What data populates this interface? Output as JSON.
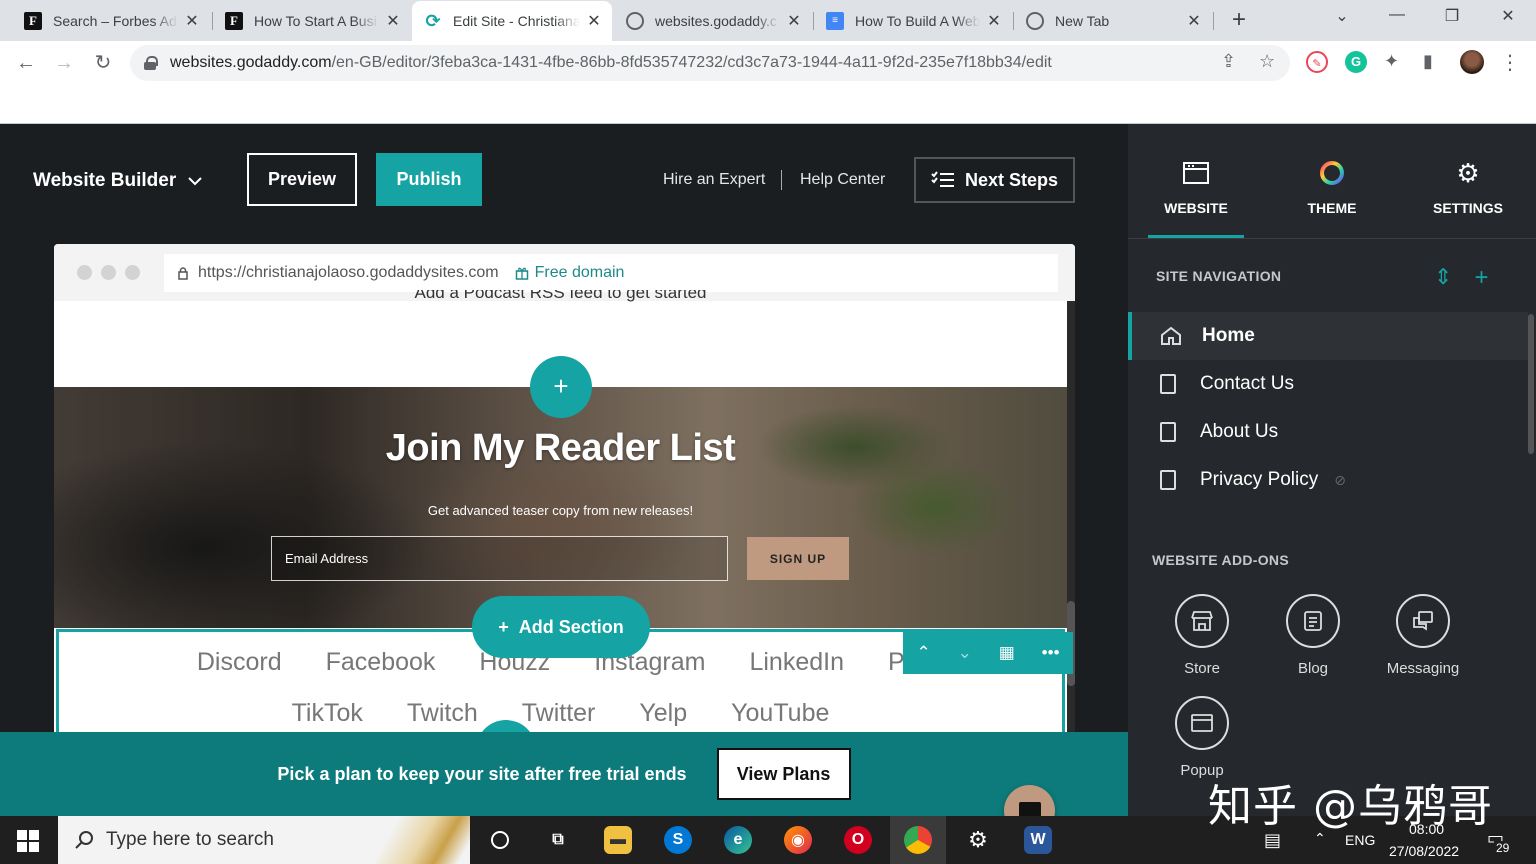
{
  "browser": {
    "tabs": [
      {
        "title": "Search – Forbes Ad",
        "favicon": "forbes-f"
      },
      {
        "title": "How To Start A Busi",
        "favicon": "forbes-f"
      },
      {
        "title": "Edit Site - Christiana",
        "favicon": "godaddy"
      },
      {
        "title": "websites.godaddy.c",
        "favicon": "globe"
      },
      {
        "title": "How To Build A Web",
        "favicon": "docs"
      },
      {
        "title": "New Tab",
        "favicon": "globe"
      }
    ],
    "favicon_letter": "F",
    "docs_glyph": "≡",
    "godaddy_glyph": "⟳",
    "close_glyph": "✕",
    "newtab_glyph": "+",
    "url_host": "websites.godaddy.com",
    "url_path": "/en-GB/editor/3feba3ca-1431-4fbe-86bb-8fd535747232/cd3c7a73-1944-4a11-9f2d-235e7f18bb34/edit",
    "grammarly_glyph": "G"
  },
  "editor": {
    "title": "Website Builder",
    "preview_label": "Preview",
    "publish_label": "Publish",
    "hire_expert": "Hire an Expert",
    "help_center": "Help Center",
    "next_steps": "Next Steps",
    "colors": {
      "accent": "#15a3a3",
      "banner": "#0d7b7b",
      "signup": "#c09a80"
    }
  },
  "preview": {
    "site_url": "https://christianajolaoso.godaddysites.com",
    "free_domain": "Free domain",
    "podcast_text": "Add a Podcast RSS feed to get started",
    "hero_title": "Join My Reader List",
    "hero_subtitle": "Get advanced teaser copy from new releases!",
    "email_placeholder": "Email Address",
    "signup_label": "SIGN UP",
    "social_row1": [
      "Discord",
      "Facebook",
      "Houzz",
      "Instagram",
      "LinkedIn",
      "Pin"
    ],
    "social_row2": [
      "TikTok",
      "Twitch",
      "Twitter",
      "Yelp",
      "YouTube"
    ],
    "add_section": "Add Section"
  },
  "banner": {
    "text": "Pick a plan to keep your site after free trial ends",
    "button": "View Plans"
  },
  "panel": {
    "tabs": [
      "WEBSITE",
      "THEME",
      "SETTINGS"
    ],
    "site_navigation": "SITE NAVIGATION",
    "pages": [
      "Home",
      "Contact Us",
      "About Us",
      "Privacy Policy"
    ],
    "addons_heading": "WEBSITE ADD-ONS",
    "addons": [
      "Store",
      "Blog",
      "Messaging",
      "Popup"
    ]
  },
  "watermark": "知乎 @乌鸦哥",
  "taskbar": {
    "search_placeholder": "Type here to search",
    "lang": "ENG",
    "time": "08:00",
    "date": "27/08/2022",
    "notifications": "29"
  }
}
